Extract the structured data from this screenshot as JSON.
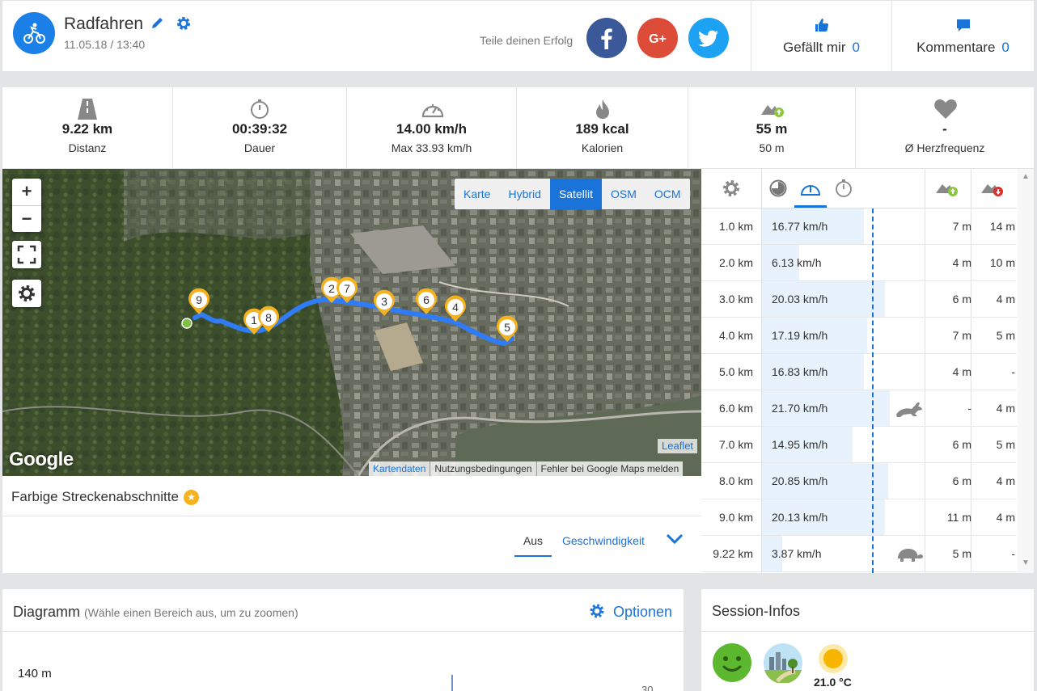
{
  "header": {
    "sport_icon": "bicycle-icon",
    "title": "Radfahren",
    "date": "11.05.18 / 13:40",
    "share_text": "Teile deinen Erfolg",
    "social": [
      {
        "name": "facebook",
        "label": "f",
        "color": "#3b5998"
      },
      {
        "name": "google-plus",
        "label": "G+",
        "color": "#dd4b39"
      },
      {
        "name": "twitter",
        "label": "twitter",
        "color": "#1da1f2"
      }
    ],
    "likes": {
      "label": "Gefällt mir",
      "count": "0"
    },
    "comments": {
      "label": "Kommentare",
      "count": "0"
    }
  },
  "stats": [
    {
      "icon": "road-icon",
      "value": "9.22 km",
      "label": "Distanz"
    },
    {
      "icon": "stopwatch-icon",
      "value": "00:39:32",
      "label": "Dauer"
    },
    {
      "icon": "speedometer-icon",
      "value": "14.00 km/h",
      "label": "Max 33.93 km/h"
    },
    {
      "icon": "flame-icon",
      "value": "189 kcal",
      "label": "Kalorien"
    },
    {
      "icon": "elevation-up-icon",
      "value": "55 m",
      "label": "50 m"
    },
    {
      "icon": "heart-icon",
      "value": "-",
      "label": "Ø Herzfrequenz"
    }
  ],
  "map": {
    "zoom_in": "+",
    "zoom_out": "−",
    "layers": [
      "Karte",
      "Hybrid",
      "Satellit",
      "OSM",
      "OCM"
    ],
    "active_layer": "Satellit",
    "google_logo": "Google",
    "leaflet": "Leaflet",
    "attribution": [
      "Kartendaten",
      "Nutzungsbedingungen",
      "Fehler bei Google Maps melden"
    ],
    "markers": [
      "9",
      "1",
      "8",
      "2",
      "7",
      "3",
      "6",
      "4",
      "5"
    ]
  },
  "segments": {
    "title": "Farbige Streckenabschnitte",
    "option_off": "Aus",
    "option_speed": "Geschwindigkeit"
  },
  "splits": {
    "rows": [
      {
        "km": "1.0 km",
        "speed": "16.77 km/h",
        "up": "7 m",
        "down": "14 m",
        "fill": 0.8,
        "animal": ""
      },
      {
        "km": "2.0 km",
        "speed": "6.13 km/h",
        "up": "4 m",
        "down": "10 m",
        "fill": 0.29,
        "animal": ""
      },
      {
        "km": "3.0 km",
        "speed": "20.03 km/h",
        "up": "6 m",
        "down": "4 m",
        "fill": 0.96,
        "animal": ""
      },
      {
        "km": "4.0 km",
        "speed": "17.19 km/h",
        "up": "7 m",
        "down": "5 m",
        "fill": 0.82,
        "animal": ""
      },
      {
        "km": "5.0 km",
        "speed": "16.83 km/h",
        "up": "4 m",
        "down": "-",
        "fill": 0.8,
        "animal": ""
      },
      {
        "km": "6.0 km",
        "speed": "21.70 km/h",
        "up": "-",
        "down": "4 m",
        "fill": 1.0,
        "animal": "rabbit-icon"
      },
      {
        "km": "7.0 km",
        "speed": "14.95 km/h",
        "up": "6 m",
        "down": "5 m",
        "fill": 0.71,
        "animal": ""
      },
      {
        "km": "8.0 km",
        "speed": "20.85 km/h",
        "up": "6 m",
        "down": "4 m",
        "fill": 0.99,
        "animal": ""
      },
      {
        "km": "9.0 km",
        "speed": "20.13 km/h",
        "up": "11 m",
        "down": "4 m",
        "fill": 0.96,
        "animal": ""
      },
      {
        "km": "9.22 km",
        "speed": "3.87 km/h",
        "up": "5 m",
        "down": "-",
        "fill": 0.16,
        "animal": "turtle-icon"
      }
    ]
  },
  "diagram": {
    "title": "Diagramm",
    "hint": "(Wähle einen Bereich aus, um zu zoomen)",
    "options": "Optionen",
    "y_label": "140 m",
    "right_label": "30"
  },
  "session_info": {
    "title": "Session-Infos",
    "temperature": "21.0 °C"
  },
  "colors": {
    "accent": "#1a73d9",
    "route": "#2f7cf6",
    "marker": "#f5b21c"
  }
}
